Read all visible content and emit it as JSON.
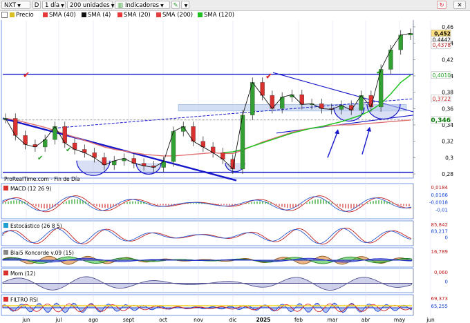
{
  "toolbar": {
    "ticker": "NXT",
    "period_letter": "D",
    "interval": "1 día",
    "units": "200 unidades",
    "indicators": "Indicadores"
  },
  "legend": [
    {
      "label": "Precio",
      "color": "#d9c020"
    },
    {
      "label": "SMA (40)",
      "color": "#e83a3a"
    },
    {
      "label": "SMA (4)",
      "color": "#111111"
    },
    {
      "label": "SMA (20)",
      "color": "#e83a3a"
    },
    {
      "label": "SMA (200)",
      "color": "#e04040"
    },
    {
      "label": "SMA (120)",
      "color": "#20c020"
    }
  ],
  "price_axis": {
    "ticks": [
      "0,46",
      "0,44",
      "0,42",
      "0,4",
      "0,38",
      "0,36",
      "0,34",
      "0,32",
      "0,3",
      "0,28"
    ],
    "price_tag": "0,452",
    "sma4_tag": "0,4442",
    "sma20_tag": "0,4378",
    "sma120_tag": "0,4010",
    "sma40_tag": "0,3722",
    "sma200_tag": "0,346"
  },
  "months": [
    "jun",
    "jul",
    "ago",
    "sept",
    "oct",
    "nov",
    "dic",
    "2025",
    "feb",
    "mar",
    "abr",
    "may",
    "jun"
  ],
  "source_text": "ProRealTime.com - Fin de Día",
  "panels": {
    "macd": {
      "title": "MACD (12 26 9)",
      "values": [
        "0,0184",
        "0,0166",
        "-0,0018",
        "-0,01"
      ]
    },
    "stoch": {
      "title": "Estocástico (26 8 5)",
      "values": [
        "85,842",
        "83,217",
        "0"
      ]
    },
    "koncorde": {
      "title": "Blai5 Koncorde v.09 (15)",
      "values": [
        "16,789"
      ]
    },
    "mom": {
      "title": "Mom (12)",
      "values": [
        "0,060",
        "0"
      ]
    },
    "rsi": {
      "title": "FILTRO RSI",
      "values": [
        "69,373",
        "65,255"
      ]
    }
  },
  "chart_data": {
    "type": "line",
    "title": "",
    "series": [
      {
        "name": "Precio",
        "values": [
          0.348,
          0.327,
          0.316,
          0.313,
          0.322,
          0.338,
          0.318,
          0.31,
          0.306,
          0.3,
          0.291,
          0.296,
          0.299,
          0.293,
          0.29,
          0.288,
          0.295,
          0.332,
          0.338,
          0.32,
          0.313,
          0.306,
          0.298,
          0.286,
          0.352,
          0.392,
          0.376,
          0.36,
          0.374,
          0.377,
          0.365,
          0.366,
          0.36,
          0.359,
          0.364,
          0.358,
          0.376,
          0.362,
          0.408,
          0.432,
          0.45,
          0.452
        ]
      },
      {
        "name": "SMA (200)",
        "values": [
          0.348,
          0.346,
          0.343,
          0.34,
          0.337,
          0.333,
          0.329,
          0.325,
          0.321,
          0.317,
          0.313,
          0.31,
          0.308,
          0.306,
          0.304,
          0.303,
          0.302,
          0.302,
          0.303,
          0.304,
          0.305,
          0.306,
          0.305,
          0.305,
          0.309,
          0.314,
          0.319,
          0.323,
          0.327,
          0.331,
          0.334,
          0.336,
          0.338,
          0.339,
          0.34,
          0.34,
          0.341,
          0.342,
          0.343,
          0.344,
          0.345,
          0.346
        ]
      },
      {
        "name": "SMA (120)",
        "values": [
          null,
          null,
          null,
          null,
          null,
          null,
          null,
          null,
          null,
          null,
          null,
          null,
          null,
          null,
          null,
          null,
          null,
          null,
          null,
          null,
          null,
          null,
          0.306,
          0.307,
          0.31,
          0.314,
          0.318,
          0.322,
          0.326,
          0.33,
          0.333,
          0.336,
          0.338,
          0.341,
          0.344,
          0.348,
          0.352,
          0.358,
          0.366,
          0.378,
          0.392,
          0.401
        ]
      }
    ],
    "ylim": [
      0.28,
      0.465
    ],
    "grid": false
  }
}
